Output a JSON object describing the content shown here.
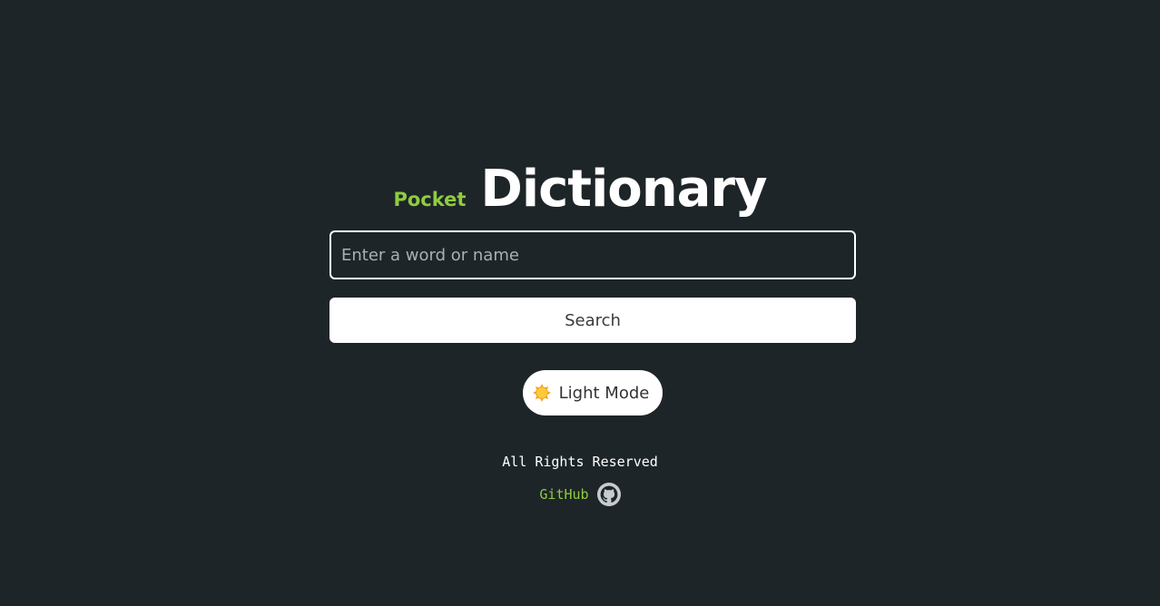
{
  "header": {
    "title_small": "Pocket",
    "title_big": "Dictionary"
  },
  "search": {
    "placeholder": "Enter a word or name",
    "value": "",
    "button_label": "Search"
  },
  "theme_toggle": {
    "label": "Light Mode",
    "icon": "sun-icon"
  },
  "footer": {
    "rights": "All Rights Reserved",
    "github_label": "GitHub",
    "github_icon": "github-icon"
  },
  "colors": {
    "background": "#1e2528",
    "accent": "#8fcc3f",
    "text": "#ffffff"
  }
}
